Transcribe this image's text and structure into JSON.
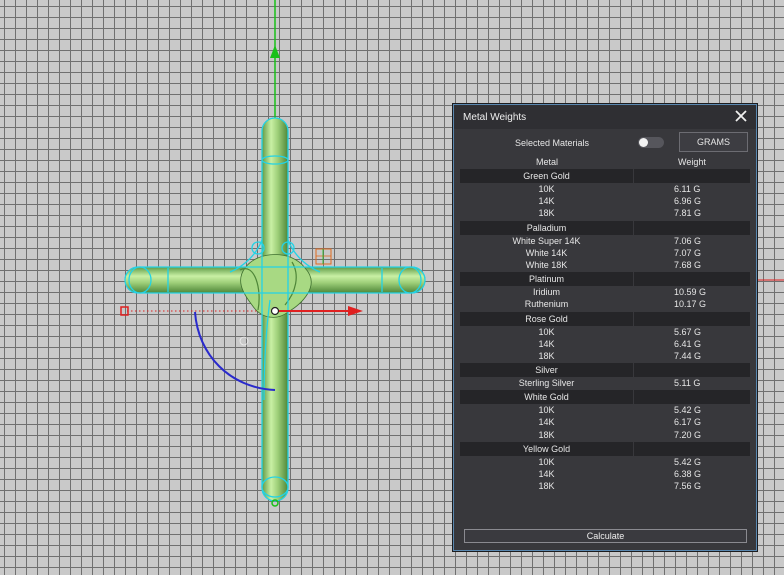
{
  "panel": {
    "title": "Metal Weights",
    "close_icon": "close-icon",
    "selected_materials_label": "Selected Materials",
    "selected_materials_on": false,
    "units_label": "GRAMS",
    "columns": {
      "metal": "Metal",
      "weight": "Weight"
    },
    "groups": [
      {
        "name": "Green Gold",
        "items": [
          {
            "name": "10K",
            "weight": "6.11 G"
          },
          {
            "name": "14K",
            "weight": "6.96 G"
          },
          {
            "name": "18K",
            "weight": "7.81 G"
          }
        ]
      },
      {
        "name": "Palladium",
        "items": [
          {
            "name": "White Super 14K",
            "weight": "7.06 G"
          },
          {
            "name": "White 14K",
            "weight": "7.07 G"
          },
          {
            "name": "White 18K",
            "weight": "7.68 G"
          }
        ]
      },
      {
        "name": "Platinum",
        "items": [
          {
            "name": "Iridium",
            "weight": "10.59 G"
          },
          {
            "name": "Ruthenium",
            "weight": "10.17 G"
          }
        ]
      },
      {
        "name": "Rose Gold",
        "items": [
          {
            "name": "10K",
            "weight": "5.67 G"
          },
          {
            "name": "14K",
            "weight": "6.41 G"
          },
          {
            "name": "18K",
            "weight": "7.44 G"
          }
        ]
      },
      {
        "name": "Silver",
        "items": [
          {
            "name": "Sterling Silver",
            "weight": "5.11 G"
          }
        ]
      },
      {
        "name": "White Gold",
        "items": [
          {
            "name": "10K",
            "weight": "5.42 G"
          },
          {
            "name": "14K",
            "weight": "6.17 G"
          },
          {
            "name": "18K",
            "weight": "7.20 G"
          }
        ]
      },
      {
        "name": "Yellow Gold",
        "items": [
          {
            "name": "10K",
            "weight": "5.42 G"
          },
          {
            "name": "14K",
            "weight": "6.38 G"
          },
          {
            "name": "18K",
            "weight": "7.56 G"
          }
        ]
      }
    ],
    "calculate_label": "Calculate"
  },
  "colors": {
    "grid_background": "#c9c9c9",
    "panel_background": "#38383c",
    "panel_border": "#5a88b0",
    "model_green": "#9fd07a",
    "selection_cyan": "#22d3e6",
    "axis_x": "#e02020",
    "axis_y": "#18c018",
    "rotation_arc": "#2a2acc"
  }
}
